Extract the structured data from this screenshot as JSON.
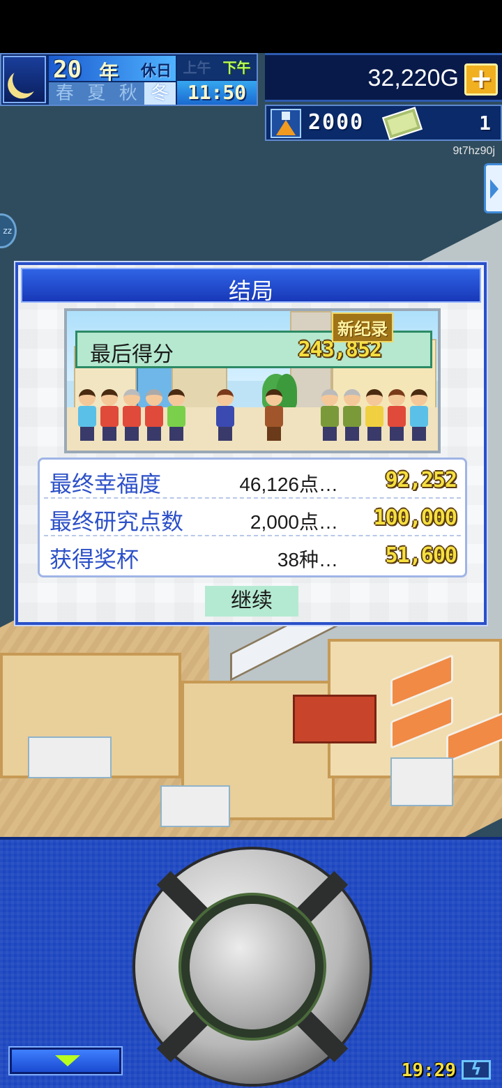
{
  "hud": {
    "year": "20",
    "year_unit": "年",
    "holiday": "休日",
    "seasons": [
      {
        "label": "春",
        "active": false
      },
      {
        "label": "夏",
        "active": false
      },
      {
        "label": "秋",
        "active": false
      },
      {
        "label": "冬",
        "active": true
      }
    ],
    "am": "上午",
    "pm": "下午",
    "time": "11:50",
    "money": "32,220G",
    "plus_label": "+",
    "research_points": "2000",
    "tickets": "1",
    "player_id": "9t7hz90j",
    "sleep_label": "zz"
  },
  "dialog": {
    "title": "结局",
    "new_record": "新纪录",
    "score_label": "最后得分",
    "score_value": "243,852",
    "stats": [
      {
        "label": "最终幸福度",
        "amount": "46,126点…",
        "score": "92,252"
      },
      {
        "label": "最终研究点数",
        "amount": "2,000点…",
        "score": "100,000"
      },
      {
        "label": "获得奖杯",
        "amount": "38种…",
        "score": "51,600"
      }
    ],
    "continue_label": "继续"
  },
  "status_bar": {
    "clock": "19:29"
  }
}
